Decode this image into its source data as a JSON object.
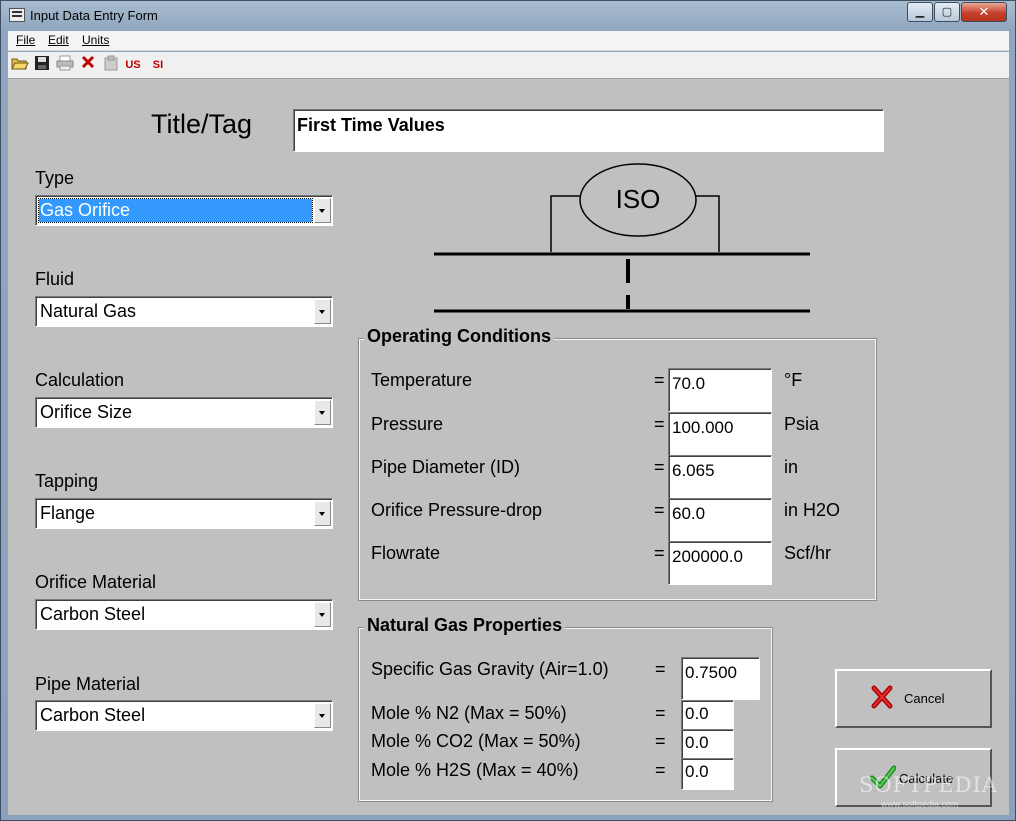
{
  "window": {
    "title": "Input Data Entry Form",
    "minimize_glyph": "▁",
    "maximize_glyph": "▢",
    "close_glyph": "✕"
  },
  "menu": {
    "file": "File",
    "edit": "Edit",
    "units": "Units"
  },
  "toolbar": {
    "open_icon": "open-folder-icon",
    "save_icon": "save-disk-icon",
    "print_icon": "printer-icon",
    "delete_icon": "red-x-icon",
    "clipboard_icon": "clipboard-icon",
    "us_label": "US",
    "si_label": "SI"
  },
  "form": {
    "title_tag_label": "Title/Tag",
    "title_tag_value": "First Time Values",
    "fields": {
      "type_label": "Type",
      "type_value": "Gas Orifice",
      "fluid_label": "Fluid",
      "fluid_value": "Natural Gas",
      "calculation_label": "Calculation",
      "calculation_value": "Orifice Size",
      "tapping_label": "Tapping",
      "tapping_value": "Flange",
      "orifice_material_label": "Orifice Material",
      "orifice_material_value": "Carbon Steel",
      "pipe_material_label": "Pipe Material",
      "pipe_material_value": "Carbon Steel"
    },
    "diagram": {
      "label": "ISO"
    }
  },
  "operating": {
    "title": "Operating Conditions",
    "eq": "=",
    "rows": [
      {
        "label": "Temperature",
        "value": "70.0",
        "unit": "°F"
      },
      {
        "label": "Pressure",
        "value": "100.000",
        "unit": "Psia"
      },
      {
        "label": "Pipe Diameter (ID)",
        "value": "6.065",
        "unit": "in"
      },
      {
        "label": "Orifice Pressure-drop",
        "value": "60.0",
        "unit": "in H2O"
      },
      {
        "label": "Flowrate",
        "value": "200000.0",
        "unit": "Scf/hr"
      }
    ]
  },
  "gas": {
    "title": "Natural Gas Properties",
    "eq": "=",
    "rows": [
      {
        "label": "Specific Gas Gravity (Air=1.0)",
        "value": "0.7500"
      },
      {
        "label": "Mole % N2 (Max = 50%)",
        "value": "0.0"
      },
      {
        "label": "Mole % CO2 (Max = 50%)",
        "value": "0.0"
      },
      {
        "label": "Mole % H2S (Max = 40%)",
        "value": "0.0"
      }
    ]
  },
  "buttons": {
    "cancel": "Cancel",
    "calculate": "Calculate",
    "cancel_icon": "red-x-icon",
    "calculate_icon": "green-check-icon"
  },
  "watermark": {
    "text": "SOFTPEDIA",
    "url": "www.softpedia.com"
  },
  "colors": {
    "form_background": "#c0c0c0",
    "selection": "#3399ff",
    "close_button": "#c5412b"
  }
}
